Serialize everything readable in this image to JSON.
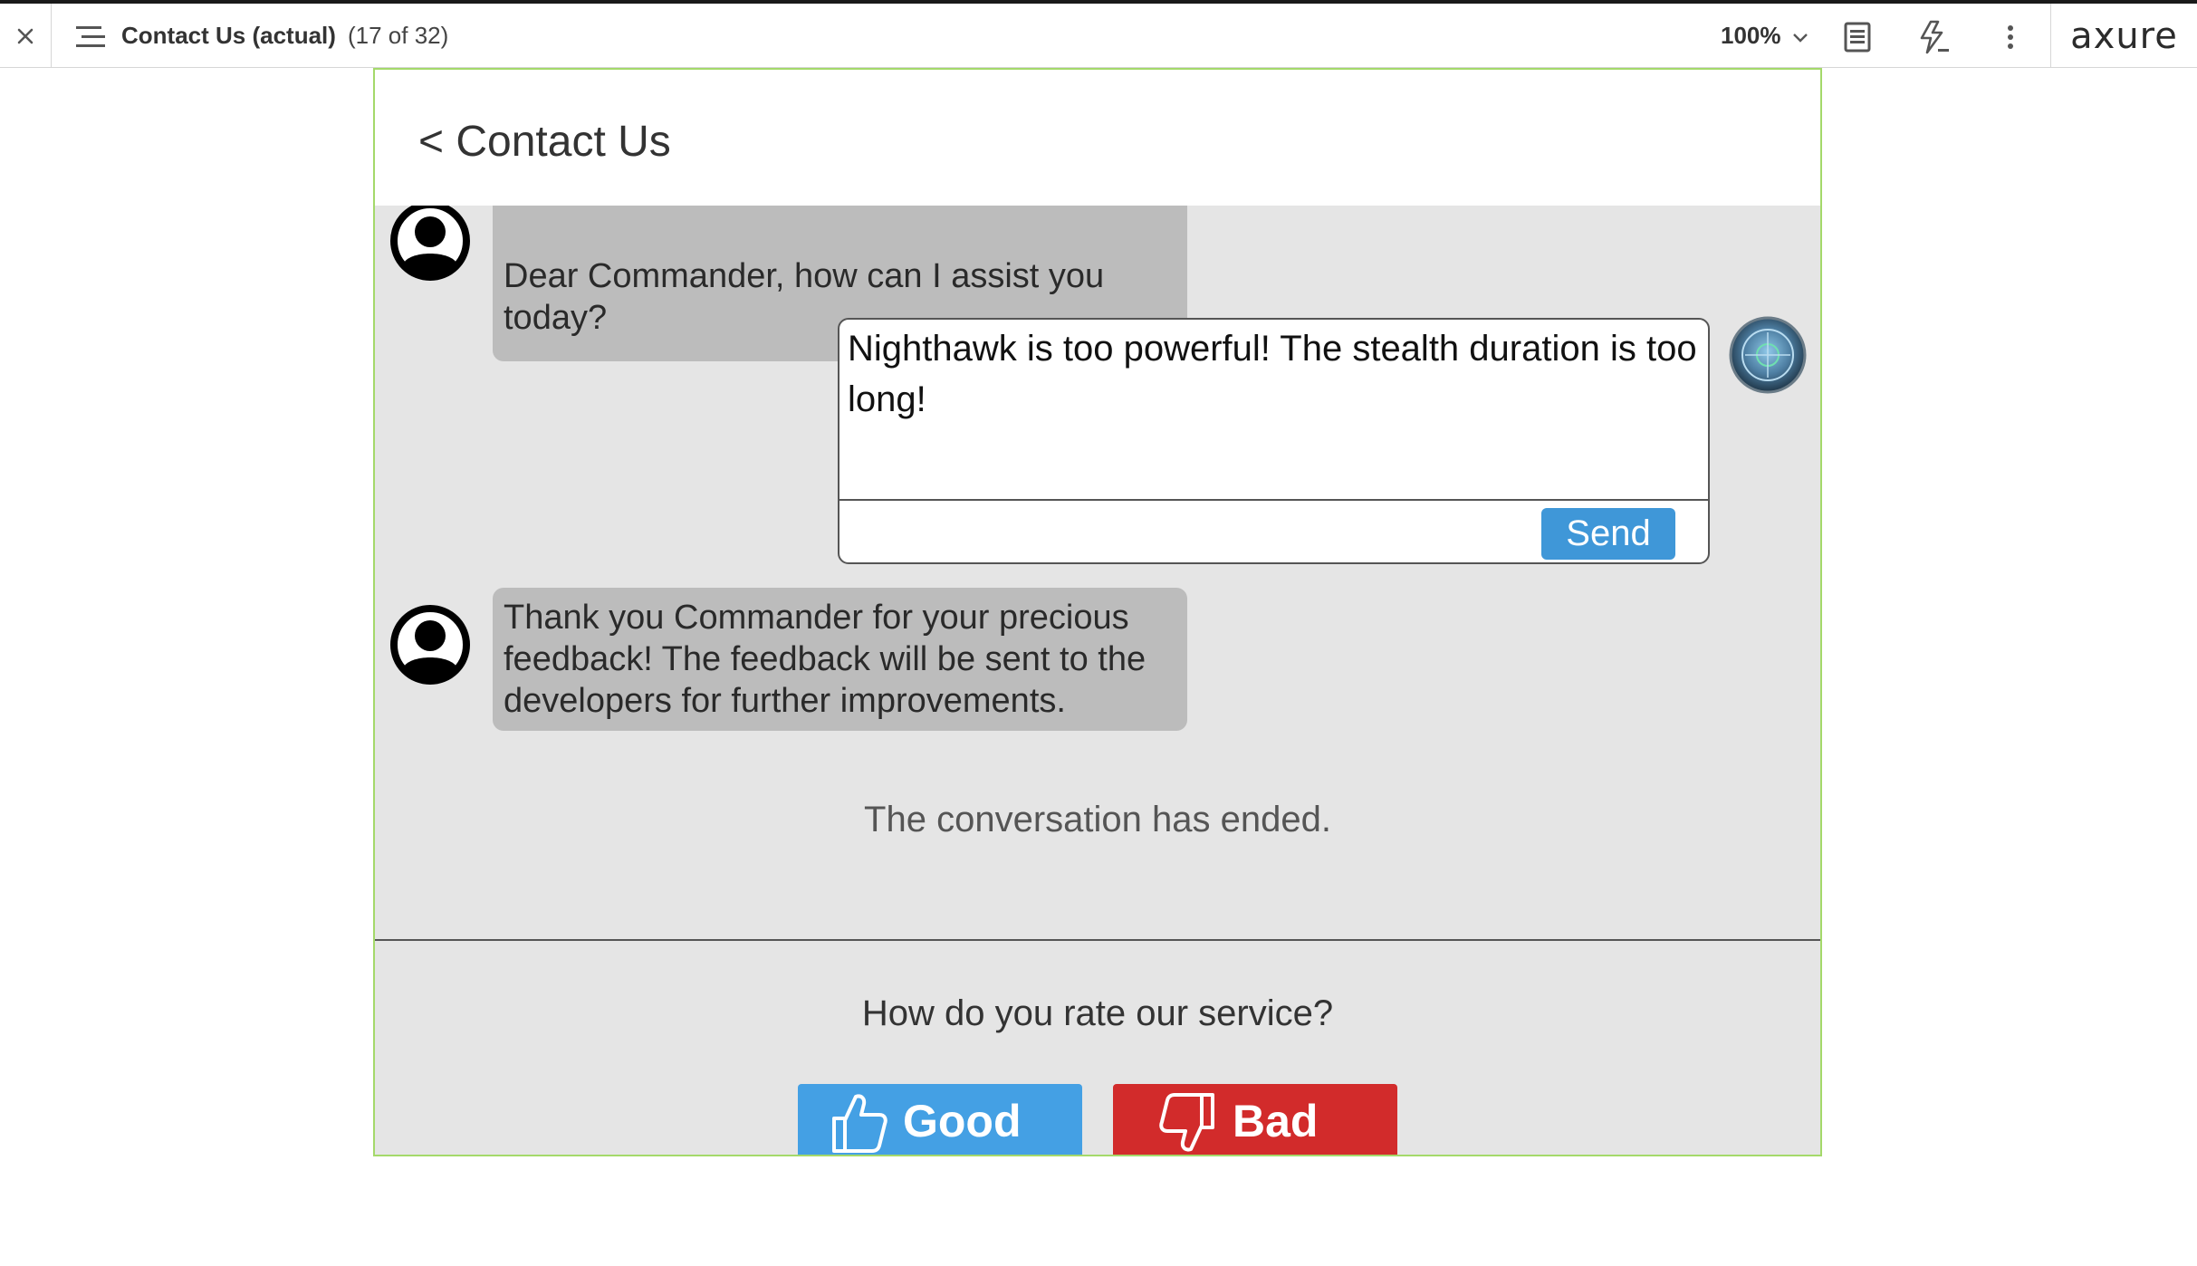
{
  "toolbar": {
    "close_icon": "close-icon",
    "pages_icon": "pages-list-icon",
    "page_title": "Contact Us (actual)",
    "page_count": "(17 of 32)",
    "zoom": "100%",
    "notes_icon": "notes-icon",
    "interactions_icon": "interactions-icon",
    "more_icon": "more-vertical-icon",
    "logo": "axure"
  },
  "header": {
    "back_label": "< Contact Us"
  },
  "chat": {
    "messages": [
      {
        "sender": "support",
        "text": "Dear Commander, how can I assist you today?"
      },
      {
        "sender": "support",
        "text": "Thank you Commander for your precious feedback! The feedback will be sent to the developers for further improvements."
      }
    ],
    "reply": {
      "text": "Nighthawk is too powerful! The stealth duration is too long!",
      "send_label": "Send"
    },
    "ended_notice": "The conversation has ended."
  },
  "rating": {
    "question": "How do you rate our service?",
    "good_label": "Good",
    "bad_label": "Bad"
  },
  "colors": {
    "frame_border": "#a4d96a",
    "send_button": "#3f97d8",
    "good_button": "#44a0e4",
    "bad_button": "#d22b2b",
    "bubble": "#bcbcbc",
    "chat_bg": "#e5e5e5"
  }
}
